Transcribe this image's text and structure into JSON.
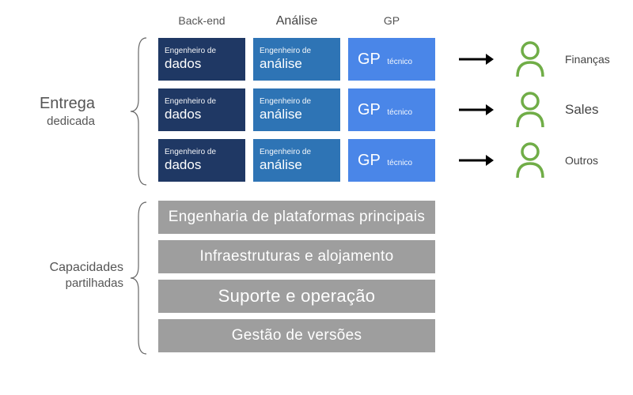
{
  "left_labels": {
    "dedicated": {
      "line1": "Entrega",
      "line2": "dedicada"
    },
    "shared": {
      "line1": "Capacidades",
      "line2": "partilhadas"
    }
  },
  "columns": {
    "backend": "Back-end",
    "analysis": "Análise",
    "pm": "GP"
  },
  "team_box": {
    "backend": {
      "small": "Engenheiro de",
      "big": "dados"
    },
    "analysis": {
      "small": "Engenheiro de",
      "big": "análise"
    },
    "pm": {
      "big": "GP",
      "small": "técnico"
    }
  },
  "stakeholders": [
    "Finanças",
    "Sales",
    "Outros"
  ],
  "shared_capabilities": [
    "Engenharia de plataformas principais",
    "Infraestruturas e alojamento",
    "Suporte e operação",
    "Gestão de versões"
  ],
  "colors": {
    "dark": "#1f3864",
    "mid": "#2e74b5",
    "light": "#4a86e8",
    "grey": "#9e9e9e",
    "person": "#70ad47"
  }
}
